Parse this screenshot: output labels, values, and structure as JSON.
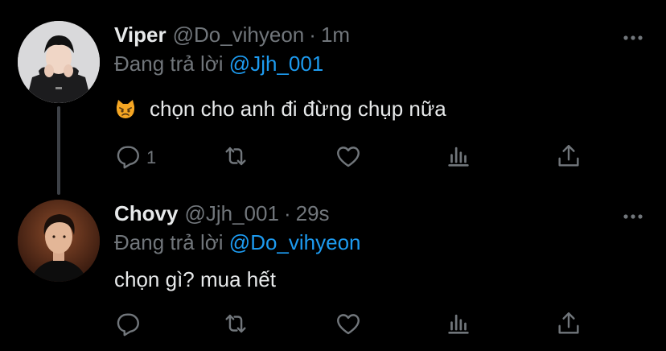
{
  "colors": {
    "background": "#000000",
    "text": "#e7e9ea",
    "muted": "#71767b",
    "mention": "#1d9bf0",
    "thread_line": "#3d4147"
  },
  "tweets": [
    {
      "name": "Viper",
      "handle": "@Do_vihyeon",
      "separator": "·",
      "time": "1m",
      "reply_prefix": "Đang trả lời",
      "reply_mention": "@Jjh_001",
      "emoji": "pouting-cat-emoji",
      "text": "chọn cho anh đi đừng chụp nữa",
      "reply_count": "1"
    },
    {
      "name": "Chovy",
      "handle": "@Jjh_001",
      "separator": "·",
      "time": "29s",
      "reply_prefix": "Đang trả lời",
      "reply_mention": "@Do_vihyeon",
      "text": "chọn gì? mua hết",
      "reply_count": ""
    }
  ],
  "icons": {
    "reply": "reply-icon",
    "retweet": "retweet-icon",
    "like": "heart-icon",
    "analytics": "analytics-icon",
    "share": "share-icon",
    "more": "more-icon"
  }
}
